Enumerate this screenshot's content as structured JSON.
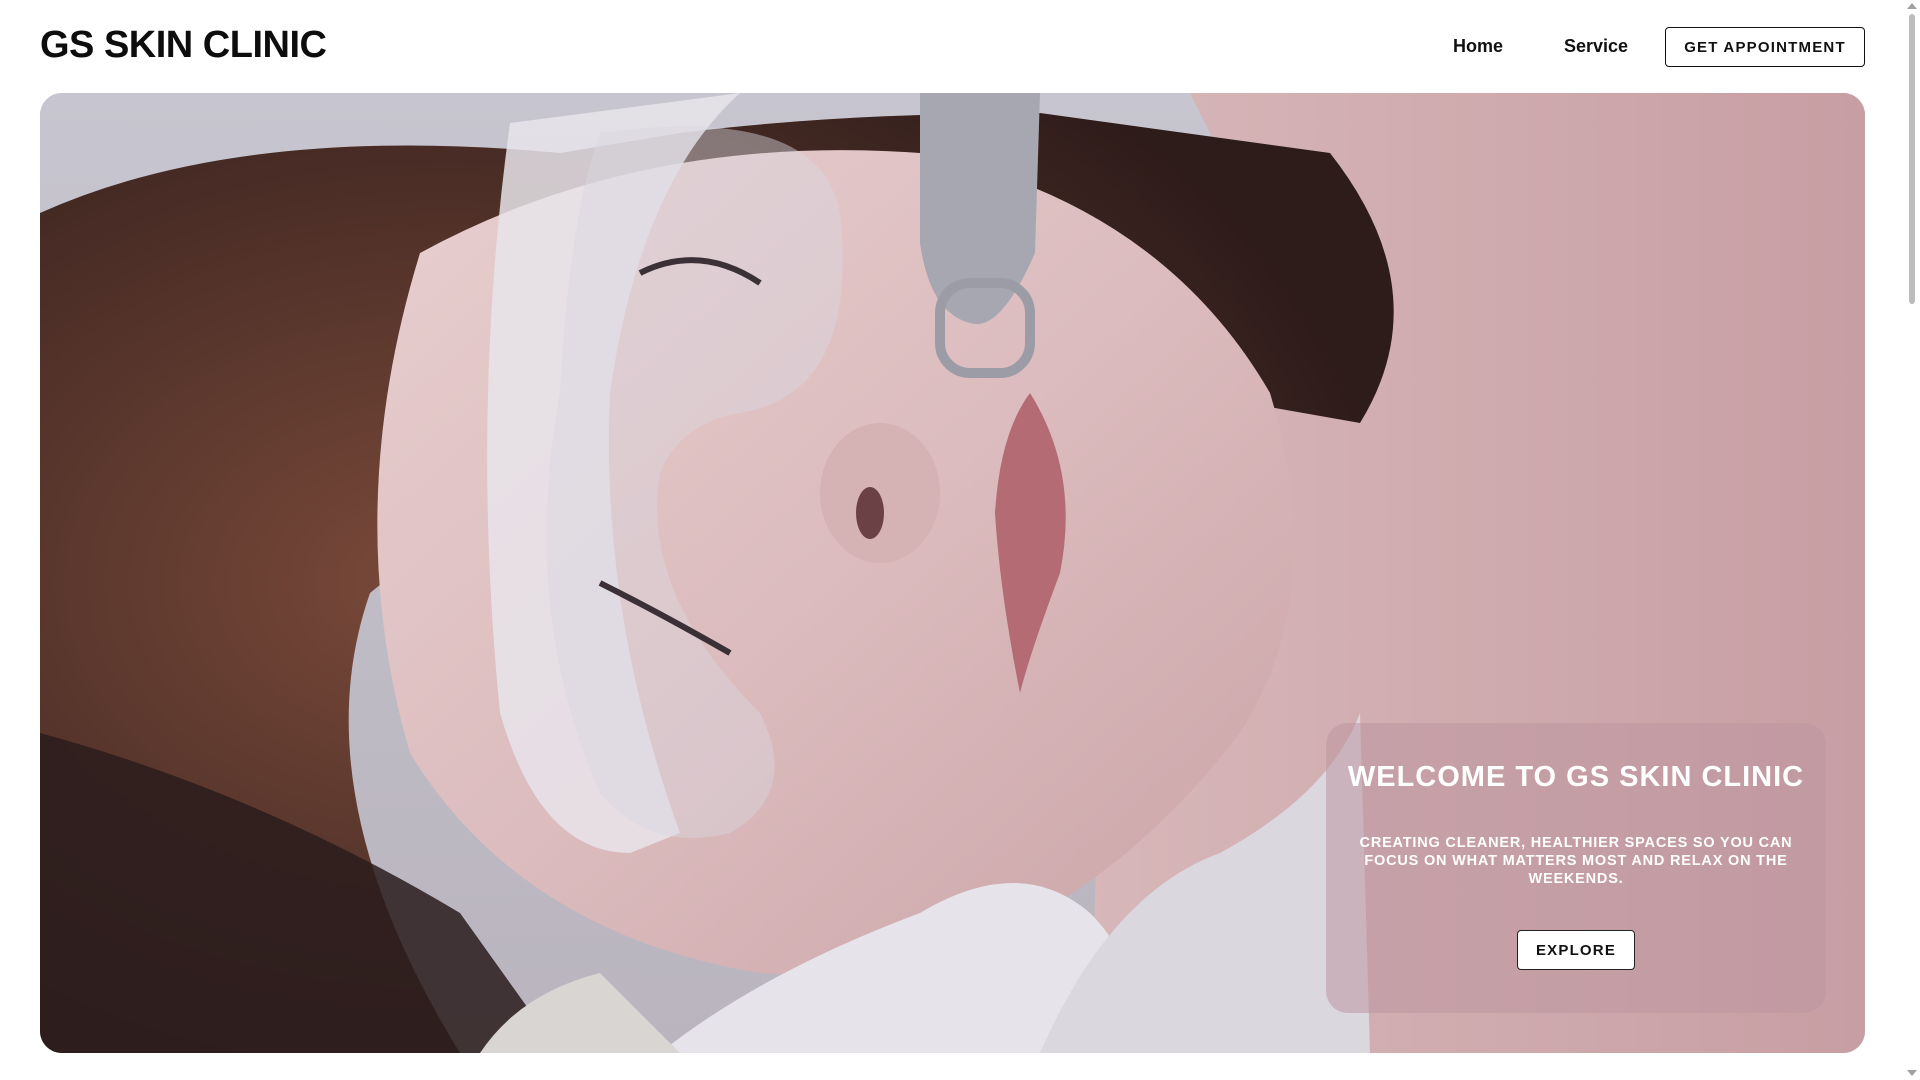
{
  "header": {
    "logo": "GS SKIN CLINIC",
    "nav": {
      "home": "Home",
      "service": "Service"
    },
    "appointment_button": "GET APPOINTMENT"
  },
  "hero": {
    "image_subject": "woman-receiving-laser-skin-treatment-with-protective-goggles",
    "card": {
      "title": "WELCOME TO GS SKIN CLINIC",
      "subtitle": "CREATING CLEANER, HEALTHIER SPACES SO YOU CAN FOCUS ON WHAT MATTERS MOST AND RELAX ON THE WEEKENDS.",
      "button": "EXPLORE"
    }
  },
  "colors": {
    "text_dark": "#111111",
    "card_overlay": "#be96a0",
    "white": "#ffffff"
  }
}
